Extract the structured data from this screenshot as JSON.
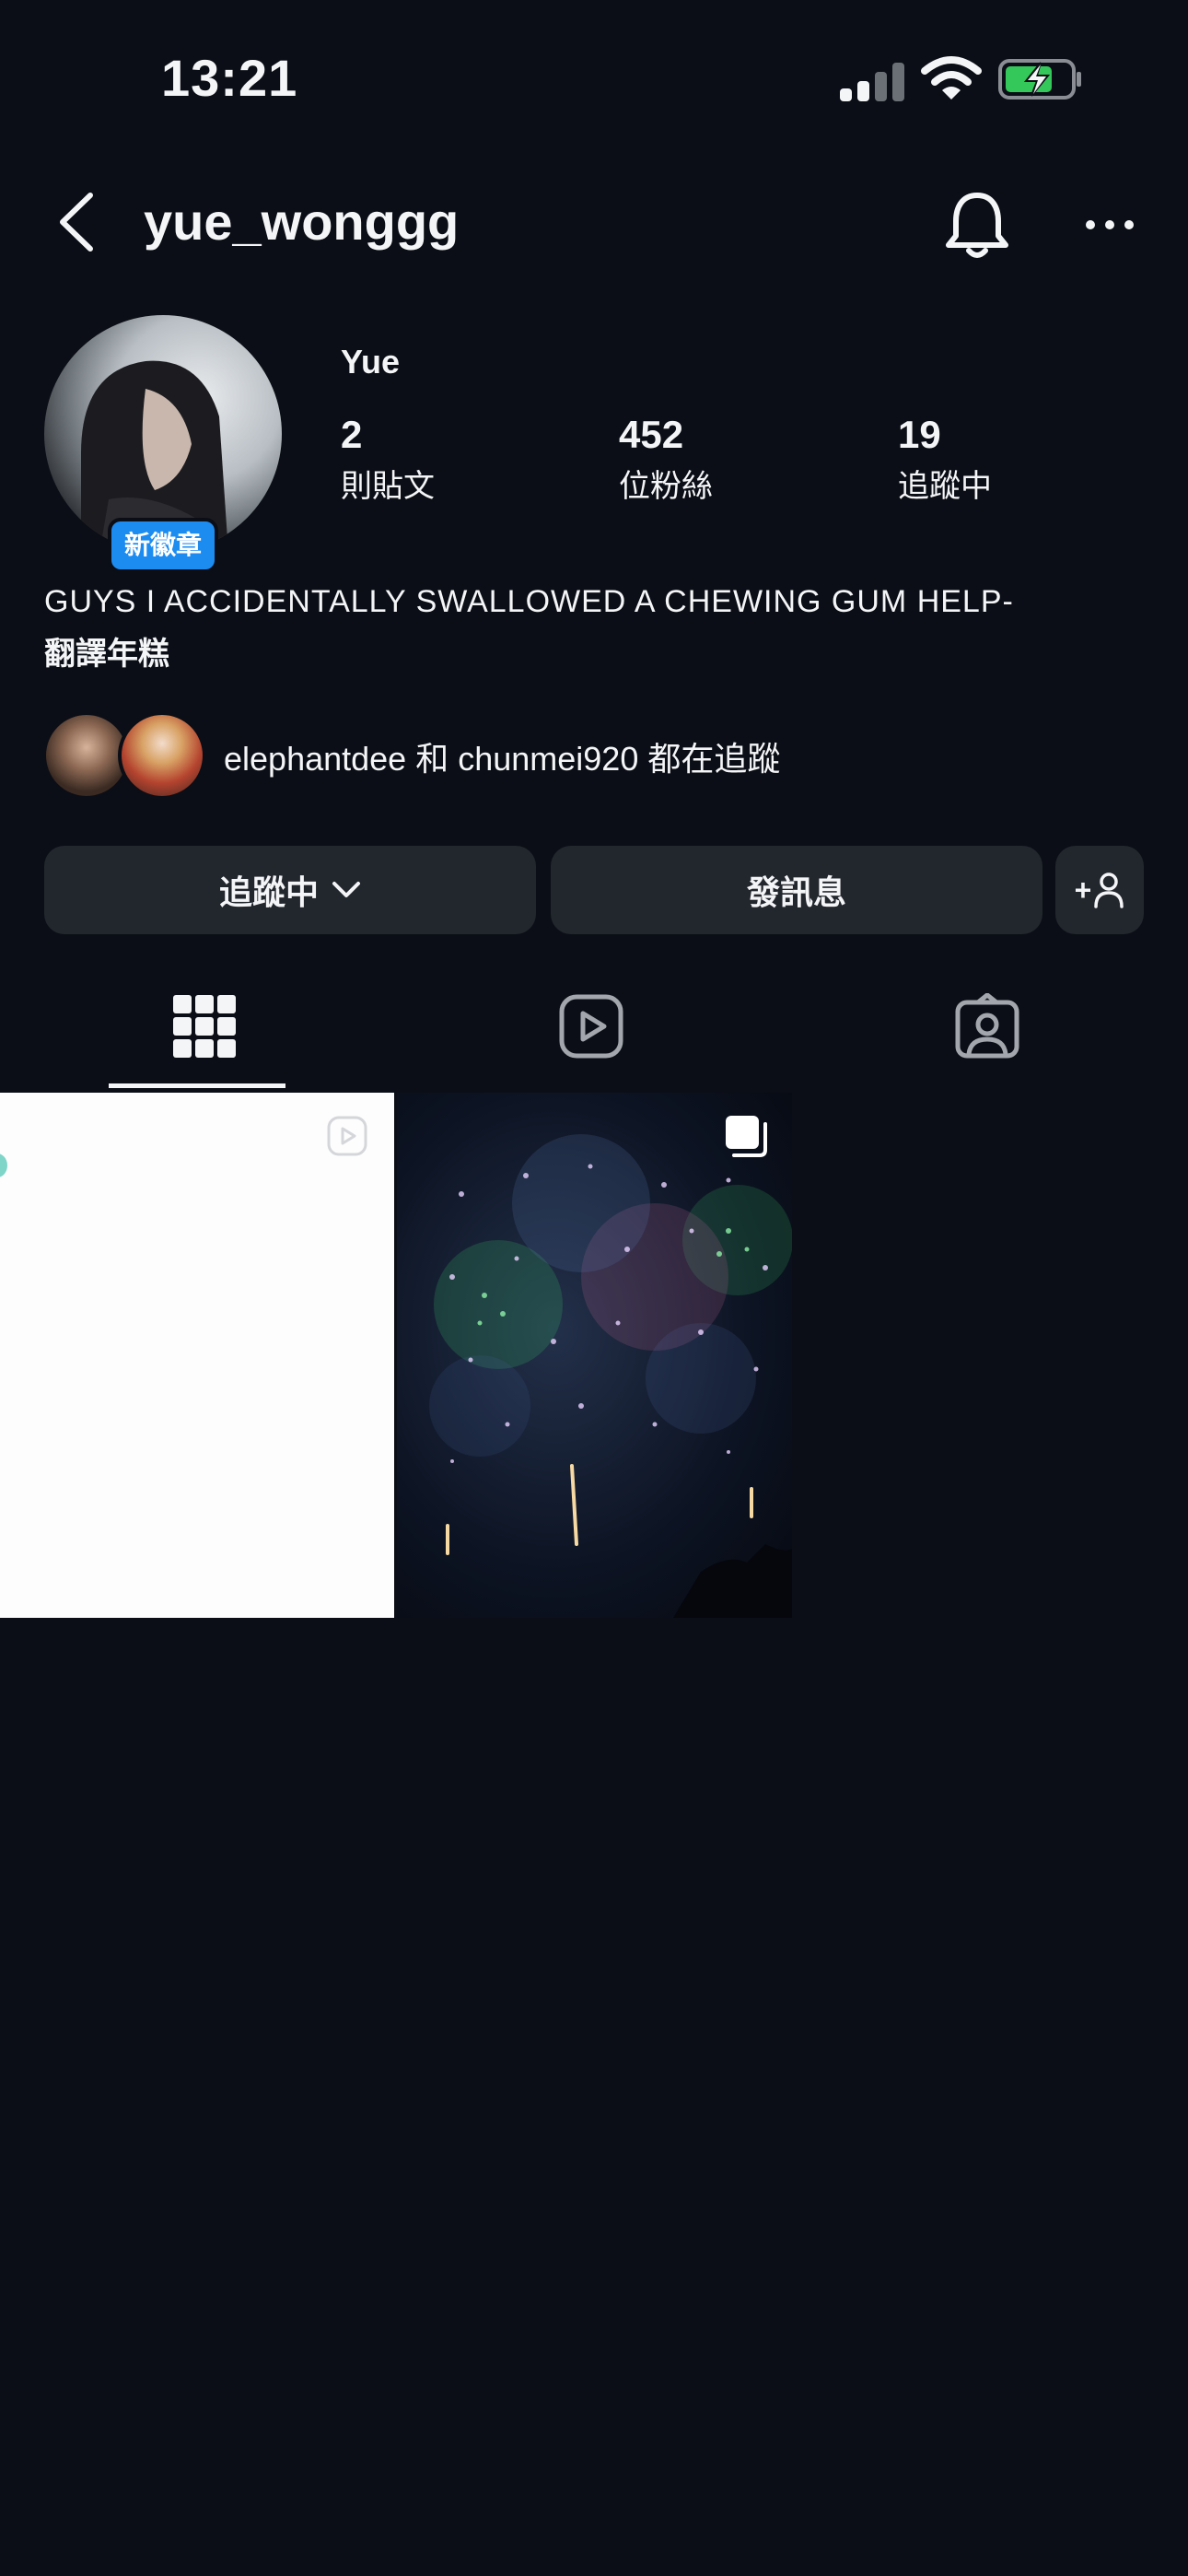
{
  "status_bar": {
    "time": "13:21"
  },
  "header": {
    "username": "yue_wonggg"
  },
  "profile": {
    "display_name": "Yue",
    "badge": "新徽章",
    "stats": [
      {
        "value": "2",
        "label": "則貼文"
      },
      {
        "value": "452",
        "label": "位粉絲"
      },
      {
        "value": "19",
        "label": "追蹤中"
      }
    ],
    "bio_line1": "GUYS I ACCIDENTALLY SWALLOWED A CHEWING GUM HELP-",
    "bio_line2": "翻譯年糕",
    "mutual_followers": "elephantdee 和 chunmei920 都在追蹤"
  },
  "actions": {
    "following_label": "追蹤中",
    "message_label": "發訊息",
    "add_person_label": "+"
  },
  "tabs": [
    "posts",
    "reels",
    "tagged"
  ],
  "posts": [
    {
      "kind": "reel"
    },
    {
      "kind": "carousel"
    }
  ]
}
